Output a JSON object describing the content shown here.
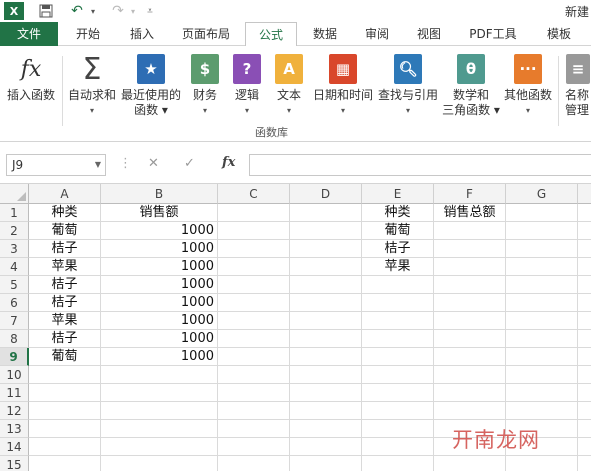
{
  "titlebar": {
    "doc_title": "新建"
  },
  "tabs": [
    {
      "label": "文件"
    },
    {
      "label": "开始"
    },
    {
      "label": "插入"
    },
    {
      "label": "页面布局"
    },
    {
      "label": "公式"
    },
    {
      "label": "数据"
    },
    {
      "label": "审阅"
    },
    {
      "label": "视图"
    },
    {
      "label": "PDF工具"
    },
    {
      "label": "模板"
    }
  ],
  "ribbon": {
    "group_label": "函数库",
    "buttons": [
      {
        "line1": "插入函数",
        "line2": "",
        "icon": "fx-icon"
      },
      {
        "line1": "自动求和",
        "line2": "▾",
        "icon": "sigma-icon"
      },
      {
        "line1": "最近使用的",
        "line2": "函数 ▾",
        "icon": "star-book-icon"
      },
      {
        "line1": "财务",
        "line2": "▾",
        "icon": "coins-book-icon"
      },
      {
        "line1": "逻辑",
        "line2": "▾",
        "icon": "question-book-icon"
      },
      {
        "line1": "文本",
        "line2": "▾",
        "icon": "text-book-icon"
      },
      {
        "line1": "日期和时间",
        "line2": "▾",
        "icon": "calendar-book-icon"
      },
      {
        "line1": "查找与引用",
        "line2": "▾",
        "icon": "search-book-icon"
      },
      {
        "line1": "数学和",
        "line2": "三角函数 ▾",
        "icon": "theta-book-icon"
      },
      {
        "line1": "其他函数",
        "line2": "▾",
        "icon": "more-book-icon"
      },
      {
        "line1": "名称",
        "line2": "管理",
        "icon": "name-manager-icon"
      }
    ]
  },
  "formula_bar": {
    "name_box": "J9",
    "fx_label": "fx",
    "cancel": "✕",
    "enter": "✓",
    "formula": ""
  },
  "sheet": {
    "columns": [
      "A",
      "B",
      "C",
      "D",
      "E",
      "F",
      "G"
    ],
    "rows": [
      "1",
      "2",
      "3",
      "4",
      "5",
      "6",
      "7",
      "8",
      "9",
      "10",
      "11",
      "12",
      "13",
      "14",
      "15"
    ],
    "selected_row": "9",
    "cells": {
      "A1": "种类",
      "B1": "销售额",
      "E1": "种类",
      "F1": "销售总额",
      "A2": "葡萄",
      "B2": "1000",
      "E2": "葡萄",
      "A3": "桔子",
      "B3": "1000",
      "E3": "桔子",
      "A4": "苹果",
      "B4": "1000",
      "E4": "苹果",
      "A5": "桔子",
      "B5": "1000",
      "A6": "桔子",
      "B6": "1000",
      "A7": "苹果",
      "B7": "1000",
      "A8": "桔子",
      "B8": "1000",
      "A9": "葡萄",
      "B9": "1000"
    }
  },
  "watermark": "开南龙网",
  "colors": {
    "accent": "#217346",
    "watermark": "#cf4a45"
  }
}
